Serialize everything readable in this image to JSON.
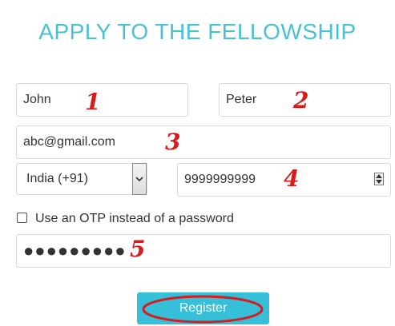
{
  "title": "APPLY TO THE FELLOWSHIP",
  "form": {
    "first_name": "John",
    "last_name": "Peter",
    "email": "abc@gmail.com",
    "country_code": "India (+91)",
    "phone": "9999999999",
    "otp_label": "Use an OTP instead of a password",
    "otp_checked": false,
    "password_mask": "●●●●●●●●●",
    "register_label": "Register"
  },
  "annotations": {
    "n1": "1",
    "n2": "2",
    "n3": "3",
    "n4": "4",
    "n5": "5",
    "color": "#d91b1b"
  },
  "colors": {
    "title": "#4bc0d4",
    "button": "#35bfd8",
    "highlight_ring": "#d91b1b"
  },
  "icons": {
    "select_arrow": "chevron-down-icon",
    "number_spinner": "spinner-icon"
  }
}
